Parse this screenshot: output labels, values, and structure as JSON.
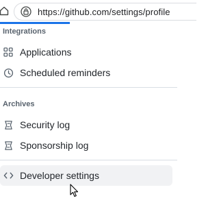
{
  "browser": {
    "url": "https://github.com/settings/profile",
    "home_icon": "home-icon",
    "site_info_icon": "site-info-icon"
  },
  "sidebar": {
    "integrations_label": "Integrations",
    "integrations_items": [
      {
        "label": "Applications",
        "icon": "apps-grid-icon"
      },
      {
        "label": "Scheduled reminders",
        "icon": "clock-icon"
      }
    ],
    "archives_label": "Archives",
    "archives_items": [
      {
        "label": "Security log",
        "icon": "log-icon"
      },
      {
        "label": "Sponsorship log",
        "icon": "log-icon"
      }
    ],
    "developer_settings": {
      "label": "Developer settings",
      "icon": "code-icon"
    }
  },
  "colors": {
    "accent": "#1a73e8",
    "selected_bg": "#f1f2f4",
    "text": "#1f2328",
    "muted_text": "#59636e"
  }
}
